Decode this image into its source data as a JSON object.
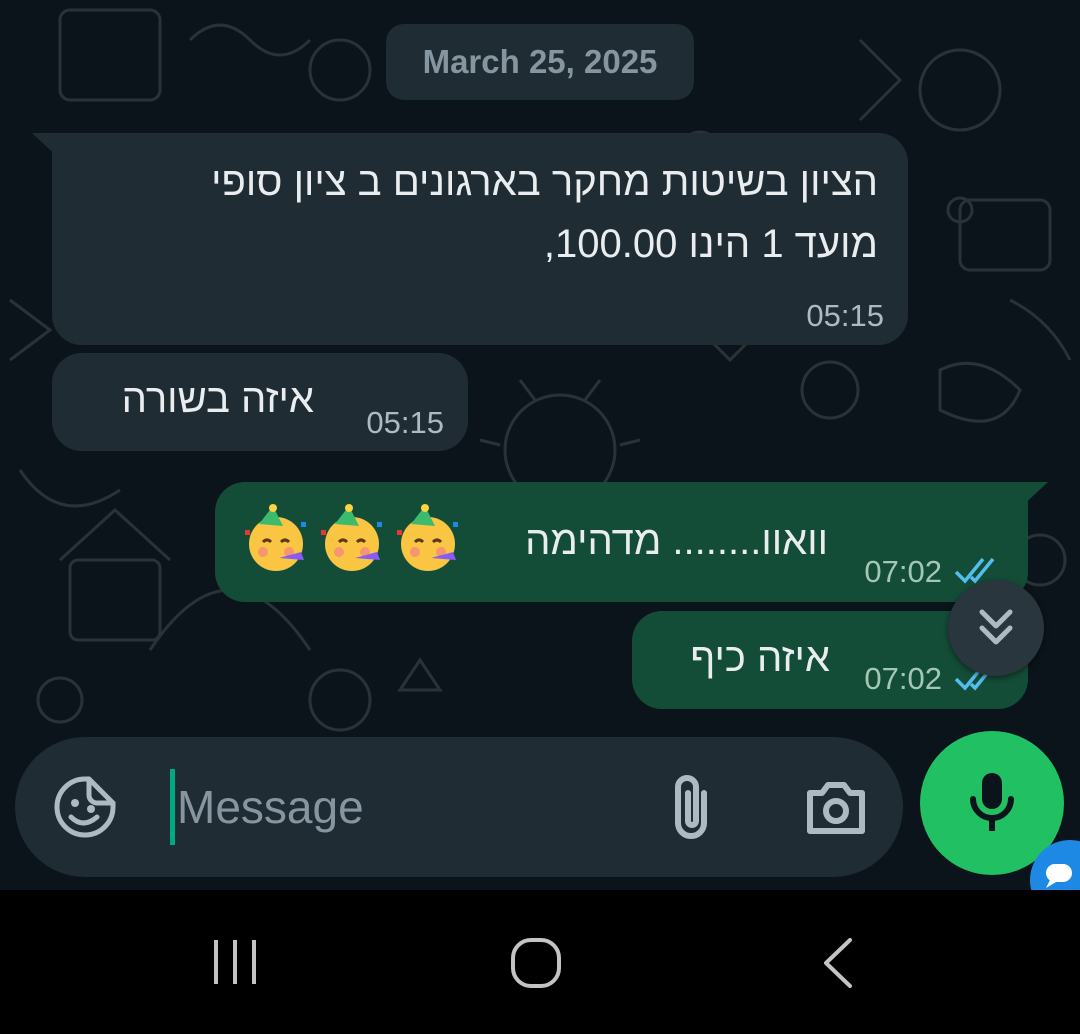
{
  "chat": {
    "date_label": "March 25, 2025",
    "messages": [
      {
        "direction": "incoming",
        "lines": [
          "הציון בשיטות מחקר בארגונים ב ציון סופי",
          "מועד 1 הינו 100.00,"
        ],
        "time": "05:15"
      },
      {
        "direction": "incoming",
        "lines": [
          "איזה בשורה"
        ],
        "time": "05:15"
      },
      {
        "direction": "outgoing",
        "lines": [
          "וואוו........ מדהימה"
        ],
        "emoji": [
          "partying-face",
          "partying-face",
          "partying-face"
        ],
        "time": "07:02",
        "status": "read"
      },
      {
        "direction": "outgoing",
        "lines": [
          "איזה כיף"
        ],
        "time": "07:02",
        "status": "read"
      }
    ]
  },
  "composer": {
    "placeholder": "Message"
  },
  "colors": {
    "background": "#0b141a",
    "incoming_bubble": "#202c33",
    "outgoing_bubble": "#144d37",
    "mic_button": "#21c063",
    "read_ticks": "#53bdeb",
    "cursor": "#00a884"
  },
  "icons": {
    "composer_left": "sticker-icon",
    "composer_attach": "paperclip-icon",
    "composer_camera": "camera-icon",
    "send": "microphone-icon",
    "scroll": "double-chevron-down-icon",
    "nav_recents": "recents-icon",
    "nav_home": "home-icon",
    "nav_back": "back-icon"
  }
}
